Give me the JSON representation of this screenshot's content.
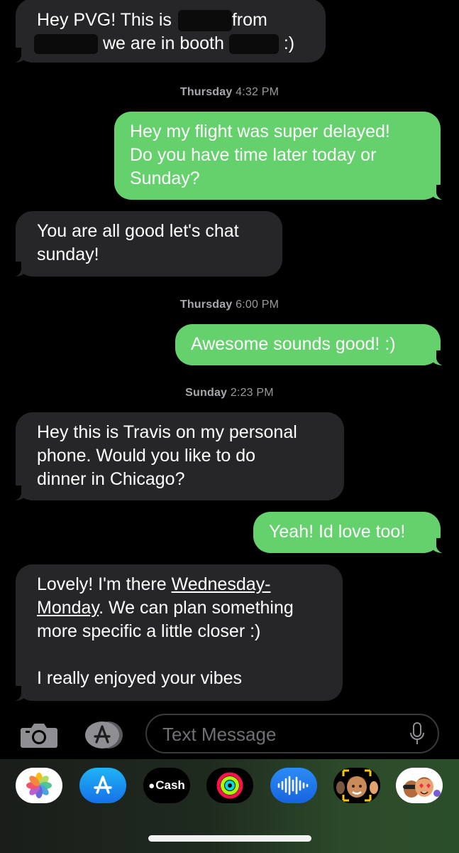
{
  "messages": [
    {
      "kind": "in",
      "lines": [
        "Hey PVG! This is ",
        "from",
        "we are in booth",
        ":)"
      ]
    },
    {
      "kind": "timestamp",
      "day": "Thursday",
      "time": "4:32 PM"
    },
    {
      "kind": "out",
      "lines": [
        "Hey my flight was super delayed!",
        "Do you have time later today or",
        "Sunday?"
      ]
    },
    {
      "kind": "in",
      "lines": [
        "You are all good let's chat",
        "sunday!"
      ]
    },
    {
      "kind": "timestamp",
      "day": "Thursday",
      "time": "6:00 PM"
    },
    {
      "kind": "out",
      "lines": [
        "Awesome sounds good! :)"
      ]
    },
    {
      "kind": "timestamp",
      "day": "Sunday",
      "time": "2:23 PM"
    },
    {
      "kind": "in",
      "lines": [
        "Hey this is Travis on my personal",
        "phone. Would you like to do",
        "dinner in Chicago?"
      ]
    },
    {
      "kind": "out",
      "lines": [
        "Yeah! Id love too!"
      ]
    },
    {
      "kind": "in",
      "lines": [
        "Lovely! I'm there ",
        "Wednesday-",
        "Monday",
        ". We can plan something",
        "more specific a little closer :)",
        "",
        "I really enjoyed your vibes"
      ]
    }
  ],
  "input": {
    "placeholder": "Text Message"
  },
  "apps": [
    {
      "name": "photos-app-icon"
    },
    {
      "name": "app-store-app-icon"
    },
    {
      "name": "cash-app-icon",
      "label": "Cash"
    },
    {
      "name": "fitness-activity-icon"
    },
    {
      "name": "audio-message-icon"
    },
    {
      "name": "memoji-icon"
    },
    {
      "name": "memoji-stickers-icon"
    }
  ],
  "colors": {
    "incoming": "#262629",
    "outgoing": "#65d16c",
    "background": "#000000",
    "timestamp": "#9a9a9f"
  }
}
